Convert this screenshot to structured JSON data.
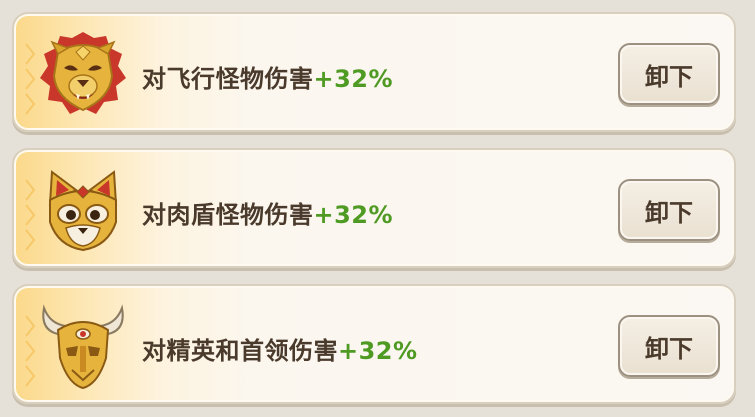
{
  "rows": [
    {
      "icon": "lion-mask-icon",
      "label": "对飞行怪物伤害",
      "bonus": "+32%",
      "button": "卸下"
    },
    {
      "icon": "fox-mask-icon",
      "label": "对肉盾怪物伤害",
      "bonus": "+32%",
      "button": "卸下"
    },
    {
      "icon": "horned-skull-icon",
      "label": "对精英和首领伤害",
      "bonus": "+32%",
      "button": "卸下"
    }
  ],
  "colors": {
    "bonus": "#4f9a22",
    "text": "#4a3a2c",
    "gold": "#d9a42a"
  }
}
